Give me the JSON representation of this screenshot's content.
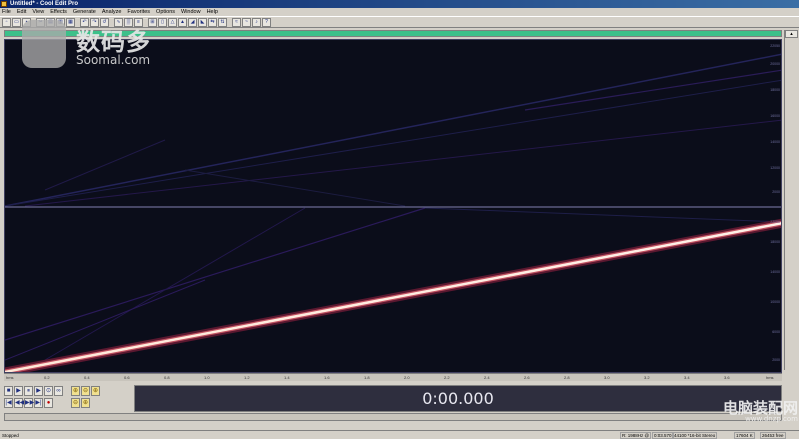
{
  "window": {
    "title": "Untitled* - Cool Edit Pro"
  },
  "menu": [
    "File",
    "Edit",
    "View",
    "Effects",
    "Generate",
    "Analyze",
    "Favorites",
    "Options",
    "Window",
    "Help"
  ],
  "transport": {
    "row1": [
      "■",
      "▶",
      "⏸",
      "▶",
      "⊙",
      "∞"
    ],
    "row2": [
      "|◀",
      "◀◀",
      "▶▶",
      "▶|",
      "●"
    ],
    "zoom": [
      "⊕",
      "⊖",
      "⊕",
      "⊖",
      "⊕"
    ]
  },
  "time_display": "0:00.000",
  "status": {
    "left": "Stopped",
    "fields": [
      "R: 1988Hz @",
      "0:03.570",
      "44100 *16-bit Stereo",
      "17604 K",
      "26453 free"
    ]
  },
  "watermark": {
    "cn": "数码多",
    "en": "Soomal.com"
  },
  "watermark2": {
    "cn": "电脑装配网",
    "en": "www.dnzp.com"
  },
  "colors": {
    "spectrogram_bg": "#0b0d1a",
    "sweep": "#f0c8a8",
    "overview": "#3cc08a"
  }
}
